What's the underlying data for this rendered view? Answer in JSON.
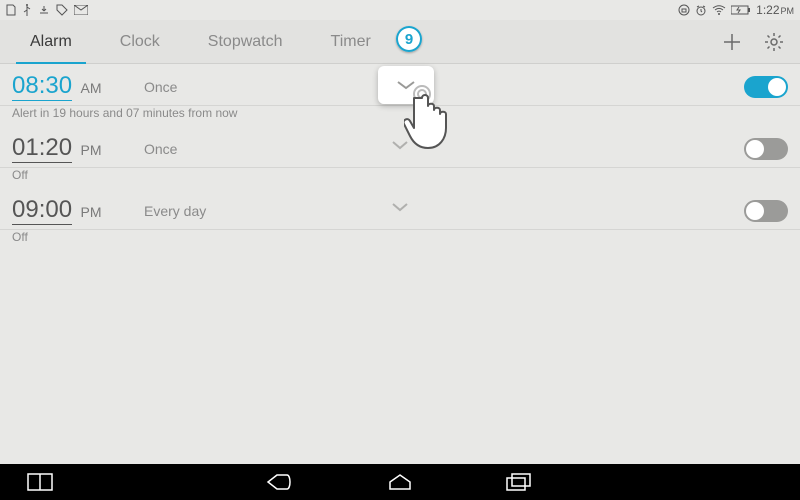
{
  "status": {
    "time": "1:22",
    "ampm": "PM"
  },
  "tabs": {
    "items": [
      {
        "label": "Alarm"
      },
      {
        "label": "Clock"
      },
      {
        "label": "Stopwatch"
      },
      {
        "label": "Timer"
      }
    ]
  },
  "step_badge": "9",
  "alarms": [
    {
      "time": "08:30",
      "ampm": "AM",
      "repeat": "Once",
      "sub": "Alert in 19 hours and 07 minutes from now",
      "enabled": true
    },
    {
      "time": "01:20",
      "ampm": "PM",
      "repeat": "Once",
      "sub": "Off",
      "enabled": false
    },
    {
      "time": "09:00",
      "ampm": "PM",
      "repeat": "Every day",
      "sub": "Off",
      "enabled": false
    }
  ]
}
